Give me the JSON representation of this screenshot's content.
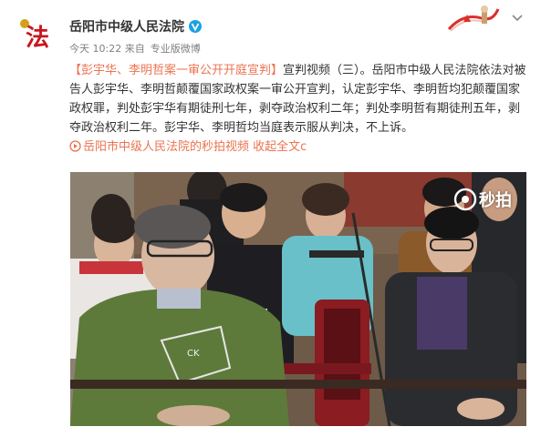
{
  "post": {
    "account_name": "岳阳市中级人民法院",
    "avatar_text": "法",
    "meta": {
      "time": "今天 10:22",
      "source_prefix": "来自",
      "source": "专业版微博"
    },
    "text_lead": "【彭宇华、李明哲案一审公开开庭宣判】",
    "text_body": "宣判视频（三）。岳阳市中级人民法院依法对被告人彭宇华、李明哲颠覆国家政权案一审公开宣判，认定彭宇华、李明哲均犯颠覆国家政权罪，判处彭宇华有期徒刑七年，剥夺政治权利二年；判处李明哲有期徒刑五年，剥夺政治权利二年。彭宇华、李明哲均当庭表示服从判决，不上诉。",
    "video_link_text": "岳阳市中级人民法院的秒拍视频",
    "expand_text": "收起全文",
    "expand_suffix": "c"
  },
  "media": {
    "watermark": "秒拍"
  },
  "icons": {
    "avatar": "court-emblem-icon",
    "verified": "verified-badge-icon",
    "menu": "chevron-down-icon",
    "video_link": "video-link-icon",
    "watermark": "miaopai-logo-icon"
  },
  "colors": {
    "link": "#eb7350",
    "verified": "#1ba1e2",
    "avatar": "#c8161d"
  }
}
